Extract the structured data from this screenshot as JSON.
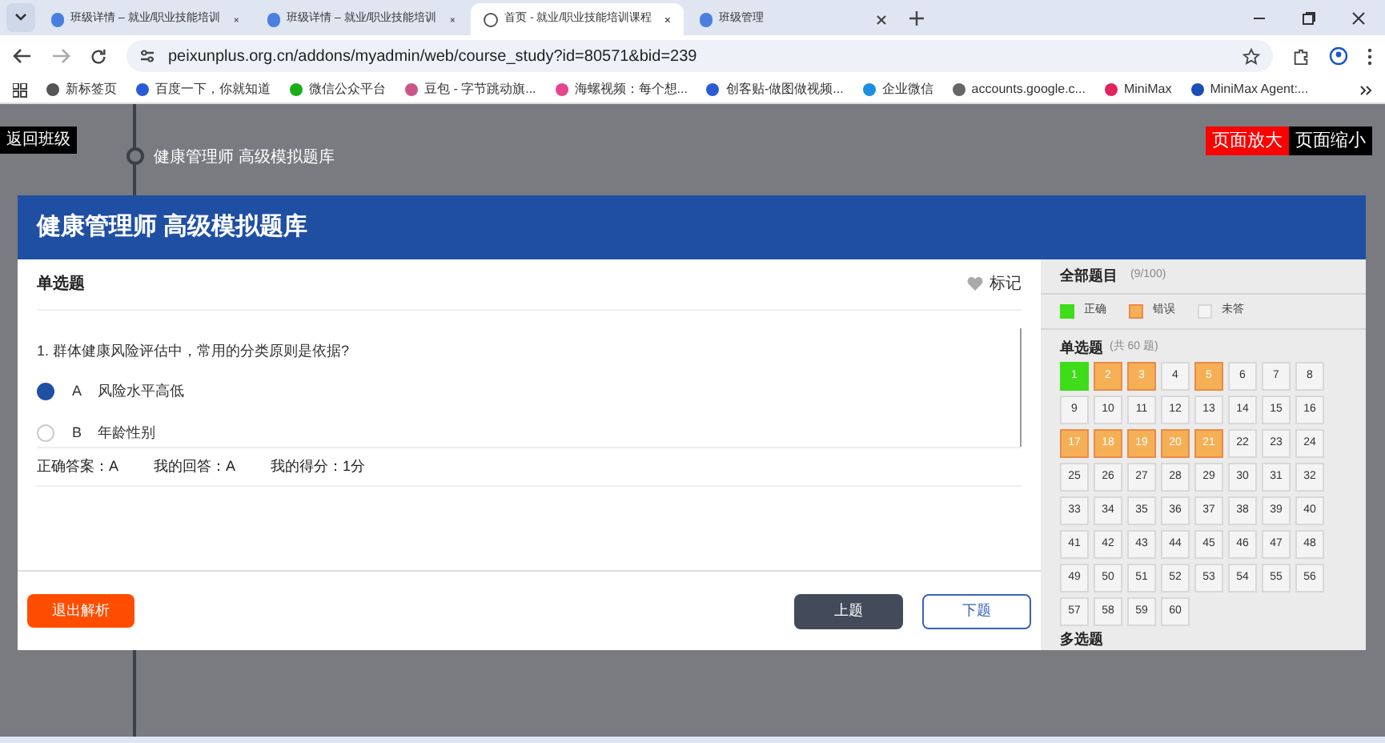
{
  "browser": {
    "tabs": [
      {
        "title": "班级详情 – 就业/职业技能培训",
        "selected": false
      },
      {
        "title": "班级详情 – 就业/职业技能培训",
        "selected": false
      },
      {
        "title": "首页 - 就业/职业技能培训课程",
        "selected": true
      },
      {
        "title": "班级管理",
        "selected": false
      }
    ],
    "url": "peixunplus.org.cn/addons/myadmin/web/course_study?id=80571&bid=239",
    "bookmarks": [
      "新标签页",
      "百度一下，你就知道",
      "微信公众平台",
      "豆包 - 字节跳动旗...",
      "海螺视频：每个想...",
      "创客贴-做图做视频...",
      "企业微信",
      "accounts.google.c...",
      "MiniMax",
      "MiniMax Agent:..."
    ]
  },
  "page": {
    "back_button": "返回班级",
    "breadcrumb": "健康管理师 高级模拟题库",
    "zoom_in": "页面放大",
    "zoom_out": "页面缩小"
  },
  "exam": {
    "title": "健康管理师 高级模拟题库",
    "section": "单选题",
    "mark_label": "标记",
    "question": "1.  群体健康风险评估中，常用的分类原则是依据?",
    "options": [
      {
        "letter": "A",
        "text": "风险水平高低",
        "selected": true
      },
      {
        "letter": "B",
        "text": "年龄性别",
        "selected": false
      }
    ],
    "result": [
      {
        "label": "正确答案：",
        "value": "A"
      },
      {
        "label": "我的回答：",
        "value": "A"
      },
      {
        "label": "我的得分：",
        "value": "1分"
      }
    ],
    "exit_button": "退出解析",
    "prev_button": "上题",
    "next_button": "下题"
  },
  "panel": {
    "title": "全部题目",
    "count": "(9/100)",
    "legend": [
      {
        "label": "正确",
        "kind": "correct"
      },
      {
        "label": "错误",
        "kind": "wrong"
      },
      {
        "label": "未答",
        "kind": "unanswered"
      }
    ],
    "groups": [
      {
        "title": "单选题",
        "count": "(共 60 题)",
        "items": [
          {
            "n": "1",
            "kind": "correct"
          },
          {
            "n": "2",
            "kind": "wrong"
          },
          {
            "n": "3",
            "kind": "wrong"
          },
          {
            "n": "4",
            "kind": "unanswered"
          },
          {
            "n": "5",
            "kind": "wrong"
          },
          {
            "n": "6",
            "kind": "unanswered"
          },
          {
            "n": "7",
            "kind": "unanswered"
          },
          {
            "n": "8",
            "kind": "unanswered"
          },
          {
            "n": "9",
            "kind": "unanswered"
          },
          {
            "n": "10",
            "kind": "unanswered"
          },
          {
            "n": "11",
            "kind": "unanswered"
          },
          {
            "n": "12",
            "kind": "unanswered"
          },
          {
            "n": "13",
            "kind": "unanswered"
          },
          {
            "n": "14",
            "kind": "unanswered"
          },
          {
            "n": "15",
            "kind": "unanswered"
          },
          {
            "n": "16",
            "kind": "unanswered"
          },
          {
            "n": "17",
            "kind": "wrong"
          },
          {
            "n": "18",
            "kind": "wrong"
          },
          {
            "n": "19",
            "kind": "wrong"
          },
          {
            "n": "20",
            "kind": "wrong"
          },
          {
            "n": "21",
            "kind": "wrong"
          },
          {
            "n": "22",
            "kind": "unanswered"
          },
          {
            "n": "23",
            "kind": "unanswered"
          },
          {
            "n": "24",
            "kind": "unanswered"
          },
          {
            "n": "25",
            "kind": "unanswered"
          },
          {
            "n": "26",
            "kind": "unanswered"
          },
          {
            "n": "27",
            "kind": "unanswered"
          },
          {
            "n": "28",
            "kind": "unanswered"
          },
          {
            "n": "29",
            "kind": "unanswered"
          },
          {
            "n": "30",
            "kind": "unanswered"
          },
          {
            "n": "31",
            "kind": "unanswered"
          },
          {
            "n": "32",
            "kind": "unanswered"
          },
          {
            "n": "33",
            "kind": "unanswered"
          },
          {
            "n": "34",
            "kind": "unanswered"
          },
          {
            "n": "35",
            "kind": "unanswered"
          },
          {
            "n": "36",
            "kind": "unanswered"
          },
          {
            "n": "37",
            "kind": "unanswered"
          },
          {
            "n": "38",
            "kind": "unanswered"
          },
          {
            "n": "39",
            "kind": "unanswered"
          },
          {
            "n": "40",
            "kind": "unanswered"
          },
          {
            "n": "41",
            "kind": "unanswered"
          },
          {
            "n": "42",
            "kind": "unanswered"
          },
          {
            "n": "43",
            "kind": "unanswered"
          },
          {
            "n": "44",
            "kind": "unanswered"
          },
          {
            "n": "45",
            "kind": "unanswered"
          },
          {
            "n": "46",
            "kind": "unanswered"
          },
          {
            "n": "47",
            "kind": "unanswered"
          },
          {
            "n": "48",
            "kind": "unanswered"
          },
          {
            "n": "49",
            "kind": "unanswered"
          },
          {
            "n": "50",
            "kind": "unanswered"
          },
          {
            "n": "51",
            "kind": "unanswered"
          },
          {
            "n": "52",
            "kind": "unanswered"
          },
          {
            "n": "53",
            "kind": "unanswered"
          },
          {
            "n": "54",
            "kind": "unanswered"
          },
          {
            "n": "55",
            "kind": "unanswered"
          },
          {
            "n": "56",
            "kind": "unanswered"
          },
          {
            "n": "57",
            "kind": "unanswered"
          },
          {
            "n": "58",
            "kind": "unanswered"
          },
          {
            "n": "59",
            "kind": "unanswered"
          },
          {
            "n": "60",
            "kind": "unanswered"
          }
        ]
      },
      {
        "title": "多选题"
      }
    ]
  }
}
